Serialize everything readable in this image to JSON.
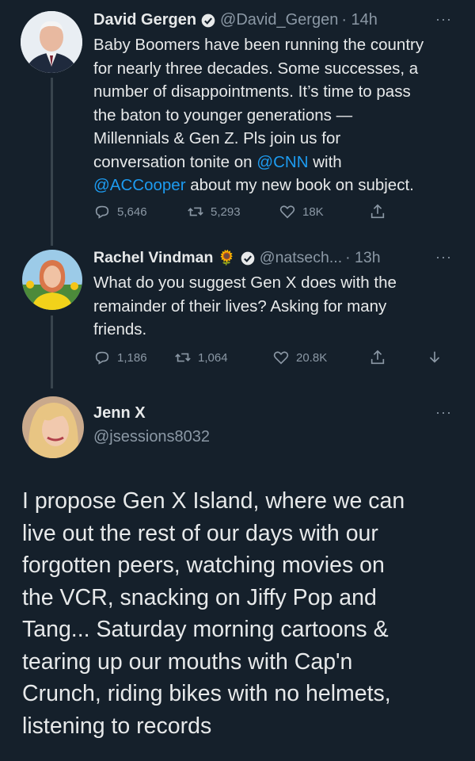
{
  "tweets": [
    {
      "name": "David Gergen",
      "handle": "@David_Gergen",
      "time": "· 14h",
      "more": "···",
      "lines": [
        {
          "pre": "Baby Boomers have been running the country"
        },
        {
          "pre": "for nearly three decades.  Some successes, a"
        },
        {
          "pre": "number of disappointments.  It’s time to pass"
        },
        {
          "pre": "the baton to younger generations —"
        },
        {
          "pre": "Millennials & Gen Z.  Pls join us for"
        },
        {
          "pre": "conversation tonite on ",
          "mention": "@CNN",
          "post": " with"
        },
        {
          "pre": "",
          "mention": "@ACCooper",
          "post": " about my new book on subject."
        }
      ],
      "stats": {
        "replies": "5,646",
        "retweets": "5,293",
        "likes": "18K"
      }
    },
    {
      "name": "Rachel Vindman",
      "emoji": "🌻",
      "handle": "@natsech...",
      "time": "· 13h",
      "more": "···",
      "lines": [
        {
          "pre": "What do you suggest Gen X does with the"
        },
        {
          "pre": "remainder of their lives? Asking for many"
        },
        {
          "pre": "friends."
        }
      ],
      "stats": {
        "replies": "1,186",
        "retweets": "1,064",
        "likes": "20.8K"
      }
    },
    {
      "name": "Jenn X",
      "handle": "@jsessions8032",
      "more": "···",
      "lines": [
        "I propose Gen X Island, where we can",
        "live out the rest of our days with our",
        "forgotten peers, watching movies on",
        "the VCR, snacking on Jiffy Pop and",
        "Tang... Saturday morning cartoons &",
        "tearing up our mouths with Cap'n",
        "Crunch, riding bikes with no helmets,",
        "listening to records"
      ]
    }
  ],
  "colors": {
    "background": "#15202b",
    "text": "#e7e9ea",
    "secondary": "#8b98a5",
    "accent": "#1d9bf0"
  },
  "icons": [
    "verified-badge-icon",
    "reply-icon",
    "retweet-icon",
    "like-icon",
    "share-icon",
    "download-icon"
  ]
}
